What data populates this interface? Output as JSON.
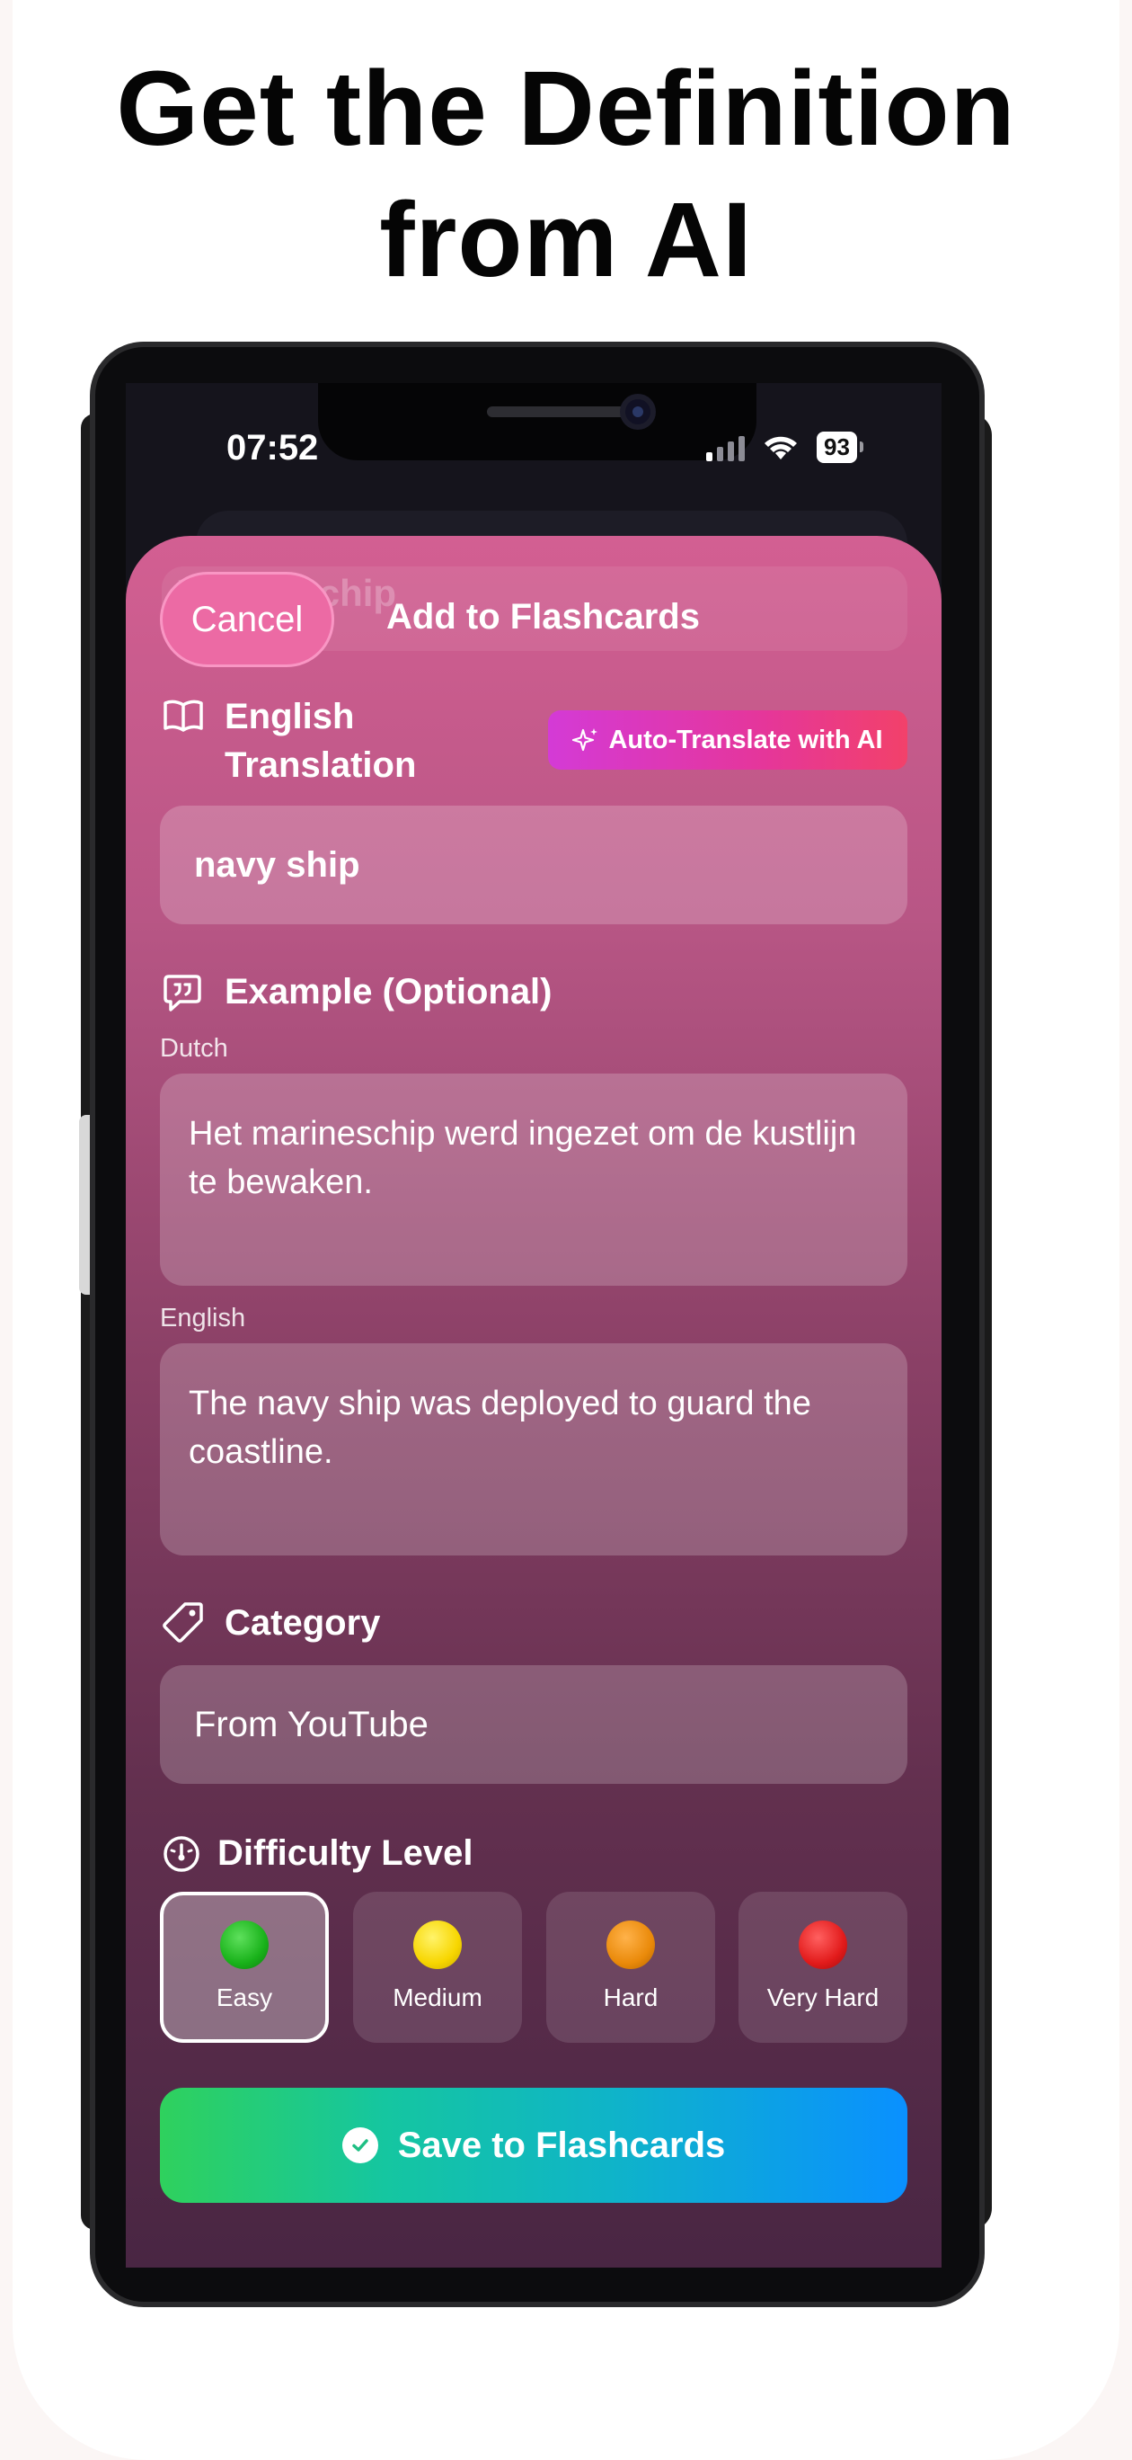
{
  "headline": {
    "line1": "Get the Definition",
    "line2": "from AI"
  },
  "status_bar": {
    "time": "07:52",
    "battery": "93"
  },
  "background_card": {
    "text": "Marineschip"
  },
  "header": {
    "cancel_label": "Cancel",
    "title": "Add to Flashcards"
  },
  "translation": {
    "label_line1": "English",
    "label_line2": "Translation",
    "ai_button": "Auto-Translate with AI",
    "value": "navy ship"
  },
  "example": {
    "label": "Example (Optional)",
    "dutch_label": "Dutch",
    "dutch_value": "Het marineschip werd ingezet om de kustlijn te bewaken.",
    "english_label": "English",
    "english_value": "The navy ship was deployed to guard the coastline."
  },
  "category": {
    "label": "Category",
    "value": "From YouTube"
  },
  "difficulty": {
    "label": "Difficulty Level",
    "selected": "Easy",
    "options": [
      {
        "label": "Easy",
        "color": "#19b21a"
      },
      {
        "label": "Medium",
        "color": "#f7d600"
      },
      {
        "label": "Hard",
        "color": "#ea8a0a"
      },
      {
        "label": "Very Hard",
        "color": "#e21b1b"
      }
    ]
  },
  "save_button": {
    "label": "Save to Flashcards"
  },
  "colors": {
    "sheet_top": "#d35f92",
    "sheet_bottom": "#492643",
    "ai_button_start": "#d43ad6",
    "ai_button_end": "#f2416a",
    "save_start": "#2fd15d",
    "save_end": "#0a90ff"
  }
}
